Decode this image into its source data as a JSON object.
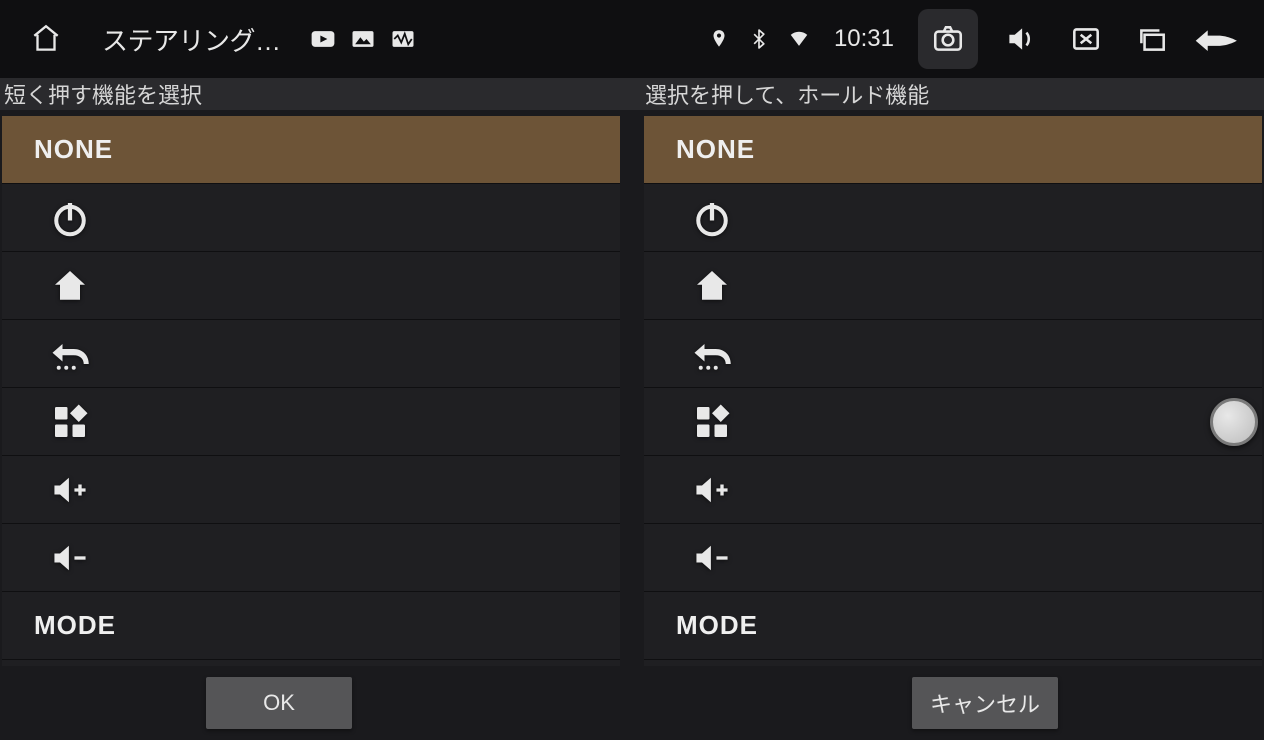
{
  "statusbar": {
    "app_title": "ステアリング…",
    "time": "10:31"
  },
  "headers": {
    "left": "短く押す機能を選択",
    "right": "選択を押して、ホールド機能"
  },
  "options": {
    "none": "NONE",
    "mode": "MODE"
  },
  "footer": {
    "ok": "OK",
    "cancel": "キャンセル"
  },
  "icons": {
    "power": "power-icon",
    "home": "home-icon",
    "back": "back-icon",
    "apps": "apps-icon",
    "vol_up": "volume-up-icon",
    "vol_down": "volume-down-icon"
  },
  "colors": {
    "bg": "#1a1a1d",
    "row": "#1f1f22",
    "sel": "#6d5437",
    "btn": "#555557"
  }
}
